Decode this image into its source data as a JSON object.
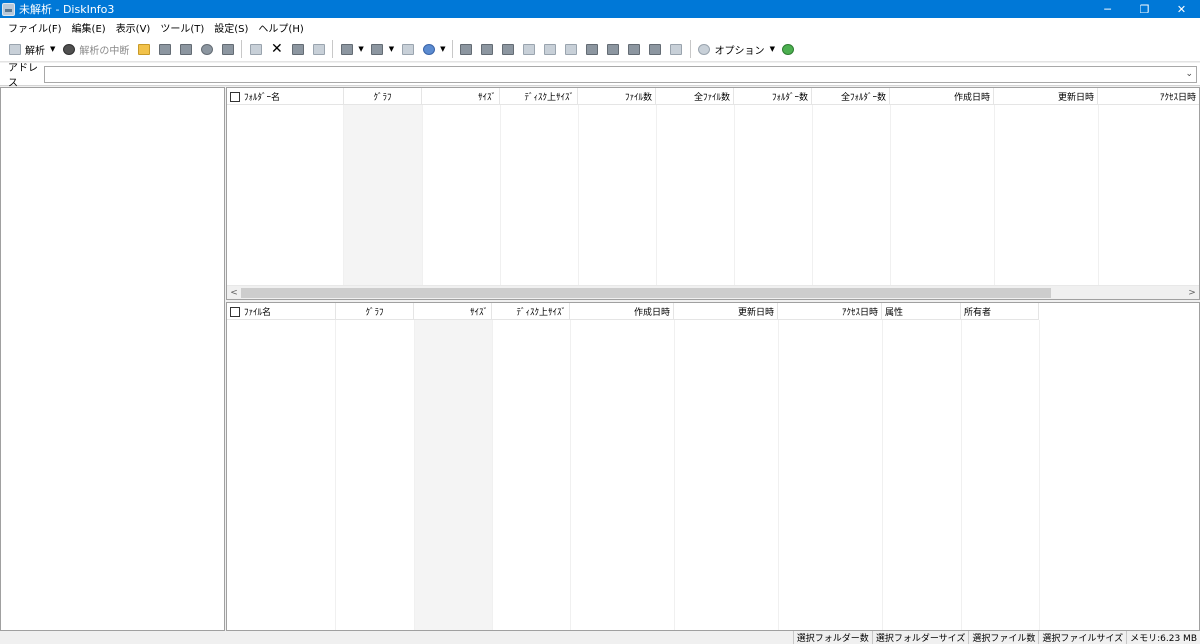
{
  "window": {
    "title": "未解析 - DiskInfo3",
    "min": "─",
    "restore": "❐",
    "close": "✕"
  },
  "menu": [
    "ファイル(F)",
    "編集(E)",
    "表示(V)",
    "ツール(T)",
    "設定(S)",
    "ヘルプ(H)"
  ],
  "toolbar": {
    "analyze_label": "解析",
    "stop_label": "解析の中断",
    "options_label": "オプション"
  },
  "address": {
    "label": "アドレス",
    "value": ""
  },
  "folder_pane": {
    "columns": [
      "ﾌｫﾙﾀﾞｰ名",
      "ｸﾞﾗﾌ",
      "ｻｲｽﾞ",
      "ﾃﾞｨｽｸ上ｻｲｽﾞ",
      "ﾌｧｲﾙ数",
      "全ﾌｧｲﾙ数",
      "ﾌｫﾙﾀﾞｰ数",
      "全ﾌｫﾙﾀﾞｰ数",
      "作成日時",
      "更新日時",
      "ｱｸｾｽ日時"
    ],
    "scroll_left": "<",
    "scroll_right": ">"
  },
  "file_pane": {
    "columns": [
      "ﾌｧｲﾙ名",
      "ｸﾞﾗﾌ",
      "ｻｲｽﾞ",
      "ﾃﾞｨｽｸ上ｻｲｽﾞ",
      "作成日時",
      "更新日時",
      "ｱｸｾｽ日時",
      "属性",
      "所有者"
    ],
    "sort_mark": "ˇ"
  },
  "status": [
    "選択フォルダー数",
    "選択フォルダーサイズ",
    "選択ファイル数",
    "選択ファイルサイズ",
    "メモリ:6.23 MB"
  ]
}
